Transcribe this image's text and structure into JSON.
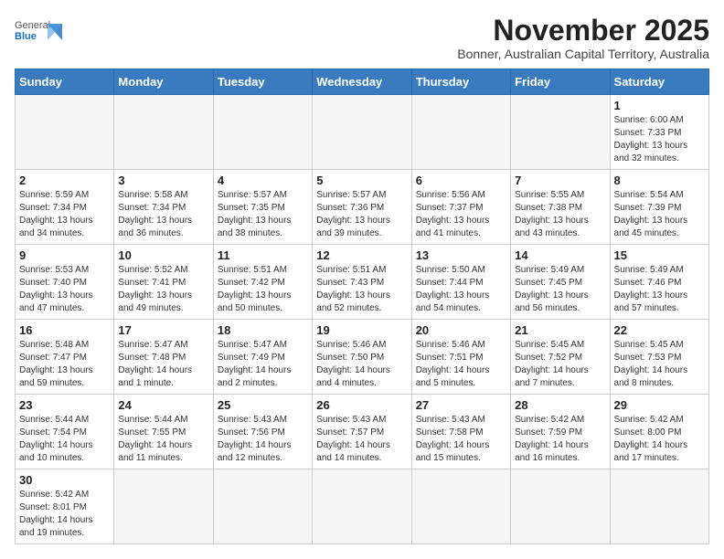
{
  "header": {
    "logo_general": "General",
    "logo_blue": "Blue",
    "month_title": "November 2025",
    "subtitle": "Bonner, Australian Capital Territory, Australia"
  },
  "weekdays": [
    "Sunday",
    "Monday",
    "Tuesday",
    "Wednesday",
    "Thursday",
    "Friday",
    "Saturday"
  ],
  "weeks": [
    [
      {
        "day": "",
        "info": ""
      },
      {
        "day": "",
        "info": ""
      },
      {
        "day": "",
        "info": ""
      },
      {
        "day": "",
        "info": ""
      },
      {
        "day": "",
        "info": ""
      },
      {
        "day": "",
        "info": ""
      },
      {
        "day": "1",
        "info": "Sunrise: 6:00 AM\nSunset: 7:33 PM\nDaylight: 13 hours\nand 32 minutes."
      }
    ],
    [
      {
        "day": "2",
        "info": "Sunrise: 5:59 AM\nSunset: 7:34 PM\nDaylight: 13 hours\nand 34 minutes."
      },
      {
        "day": "3",
        "info": "Sunrise: 5:58 AM\nSunset: 7:34 PM\nDaylight: 13 hours\nand 36 minutes."
      },
      {
        "day": "4",
        "info": "Sunrise: 5:57 AM\nSunset: 7:35 PM\nDaylight: 13 hours\nand 38 minutes."
      },
      {
        "day": "5",
        "info": "Sunrise: 5:57 AM\nSunset: 7:36 PM\nDaylight: 13 hours\nand 39 minutes."
      },
      {
        "day": "6",
        "info": "Sunrise: 5:56 AM\nSunset: 7:37 PM\nDaylight: 13 hours\nand 41 minutes."
      },
      {
        "day": "7",
        "info": "Sunrise: 5:55 AM\nSunset: 7:38 PM\nDaylight: 13 hours\nand 43 minutes."
      },
      {
        "day": "8",
        "info": "Sunrise: 5:54 AM\nSunset: 7:39 PM\nDaylight: 13 hours\nand 45 minutes."
      }
    ],
    [
      {
        "day": "9",
        "info": "Sunrise: 5:53 AM\nSunset: 7:40 PM\nDaylight: 13 hours\nand 47 minutes."
      },
      {
        "day": "10",
        "info": "Sunrise: 5:52 AM\nSunset: 7:41 PM\nDaylight: 13 hours\nand 49 minutes."
      },
      {
        "day": "11",
        "info": "Sunrise: 5:51 AM\nSunset: 7:42 PM\nDaylight: 13 hours\nand 50 minutes."
      },
      {
        "day": "12",
        "info": "Sunrise: 5:51 AM\nSunset: 7:43 PM\nDaylight: 13 hours\nand 52 minutes."
      },
      {
        "day": "13",
        "info": "Sunrise: 5:50 AM\nSunset: 7:44 PM\nDaylight: 13 hours\nand 54 minutes."
      },
      {
        "day": "14",
        "info": "Sunrise: 5:49 AM\nSunset: 7:45 PM\nDaylight: 13 hours\nand 56 minutes."
      },
      {
        "day": "15",
        "info": "Sunrise: 5:49 AM\nSunset: 7:46 PM\nDaylight: 13 hours\nand 57 minutes."
      }
    ],
    [
      {
        "day": "16",
        "info": "Sunrise: 5:48 AM\nSunset: 7:47 PM\nDaylight: 13 hours\nand 59 minutes."
      },
      {
        "day": "17",
        "info": "Sunrise: 5:47 AM\nSunset: 7:48 PM\nDaylight: 14 hours\nand 1 minute."
      },
      {
        "day": "18",
        "info": "Sunrise: 5:47 AM\nSunset: 7:49 PM\nDaylight: 14 hours\nand 2 minutes."
      },
      {
        "day": "19",
        "info": "Sunrise: 5:46 AM\nSunset: 7:50 PM\nDaylight: 14 hours\nand 4 minutes."
      },
      {
        "day": "20",
        "info": "Sunrise: 5:46 AM\nSunset: 7:51 PM\nDaylight: 14 hours\nand 5 minutes."
      },
      {
        "day": "21",
        "info": "Sunrise: 5:45 AM\nSunset: 7:52 PM\nDaylight: 14 hours\nand 7 minutes."
      },
      {
        "day": "22",
        "info": "Sunrise: 5:45 AM\nSunset: 7:53 PM\nDaylight: 14 hours\nand 8 minutes."
      }
    ],
    [
      {
        "day": "23",
        "info": "Sunrise: 5:44 AM\nSunset: 7:54 PM\nDaylight: 14 hours\nand 10 minutes."
      },
      {
        "day": "24",
        "info": "Sunrise: 5:44 AM\nSunset: 7:55 PM\nDaylight: 14 hours\nand 11 minutes."
      },
      {
        "day": "25",
        "info": "Sunrise: 5:43 AM\nSunset: 7:56 PM\nDaylight: 14 hours\nand 12 minutes."
      },
      {
        "day": "26",
        "info": "Sunrise: 5:43 AM\nSunset: 7:57 PM\nDaylight: 14 hours\nand 14 minutes."
      },
      {
        "day": "27",
        "info": "Sunrise: 5:43 AM\nSunset: 7:58 PM\nDaylight: 14 hours\nand 15 minutes."
      },
      {
        "day": "28",
        "info": "Sunrise: 5:42 AM\nSunset: 7:59 PM\nDaylight: 14 hours\nand 16 minutes."
      },
      {
        "day": "29",
        "info": "Sunrise: 5:42 AM\nSunset: 8:00 PM\nDaylight: 14 hours\nand 17 minutes."
      }
    ],
    [
      {
        "day": "30",
        "info": "Sunrise: 5:42 AM\nSunset: 8:01 PM\nDaylight: 14 hours\nand 19 minutes."
      },
      {
        "day": "",
        "info": ""
      },
      {
        "day": "",
        "info": ""
      },
      {
        "day": "",
        "info": ""
      },
      {
        "day": "",
        "info": ""
      },
      {
        "day": "",
        "info": ""
      },
      {
        "day": "",
        "info": ""
      }
    ]
  ]
}
